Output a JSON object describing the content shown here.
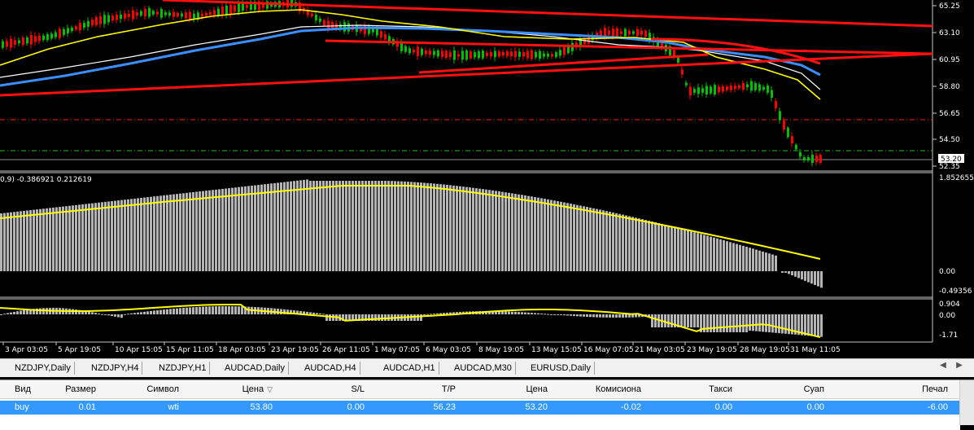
{
  "chart_data": {
    "type": "line",
    "title": "",
    "symbol": "",
    "price_axis": {
      "ticks": [
        "65.25",
        "63.10",
        "60.95",
        "58.80",
        "56.65",
        "54.50",
        "52.35"
      ],
      "current": "53.20"
    },
    "time_axis": [
      "3 Apr 03:05",
      "5 Apr 19:05",
      "10 Apr 15:05",
      "15 Apr 11:05",
      "18 Apr 03:05",
      "23 Apr 19:05",
      "26 Apr 11:05",
      "1 May 07:05",
      "6 May 03:05",
      "8 May 19:05",
      "13 May 15:05",
      "16 May 07:05",
      "21 May 03:05",
      "23 May 19:05",
      "28 May 19:05",
      "31 May 11:05"
    ],
    "indicator1": {
      "label": "0,9) -0.386921 0.212619",
      "axis_ticks": [
        "1.852655",
        "0.00",
        "-0.49356"
      ]
    },
    "indicator2": {
      "axis_ticks": [
        "0.904",
        "0.00",
        "-1.71"
      ]
    },
    "colors": {
      "bull": "#00c000",
      "bear": "#ff0000",
      "trendline": "#ff1010",
      "ma_yellow": "#ffff00",
      "ma_blue": "#3a8fff",
      "ma_white": "#ffffff",
      "hist": "#b4b4b4"
    }
  },
  "tabs": {
    "items": [
      "NZDJPY,Daily",
      "NZDJPY,H4",
      "NZDJPY,H1",
      "AUDCAD,Daily",
      "AUDCAD,H4",
      "AUDCAD,H1",
      "AUDCAD,M30",
      "EURUSD,Daily"
    ]
  },
  "terminal": {
    "columns": [
      "Вид",
      "Размер",
      "Символ",
      "Цена",
      "S/L",
      "T/P",
      "Цена",
      "Комисиона",
      "Такси",
      "Суап",
      "Печал"
    ],
    "sort_arrow": "▽",
    "rows": [
      [
        "buy",
        "0.01",
        "wti",
        "53.80",
        "0.00",
        "56.23",
        "53.20",
        "-0.02",
        "0.00",
        "0.00",
        "-6.00"
      ]
    ]
  }
}
